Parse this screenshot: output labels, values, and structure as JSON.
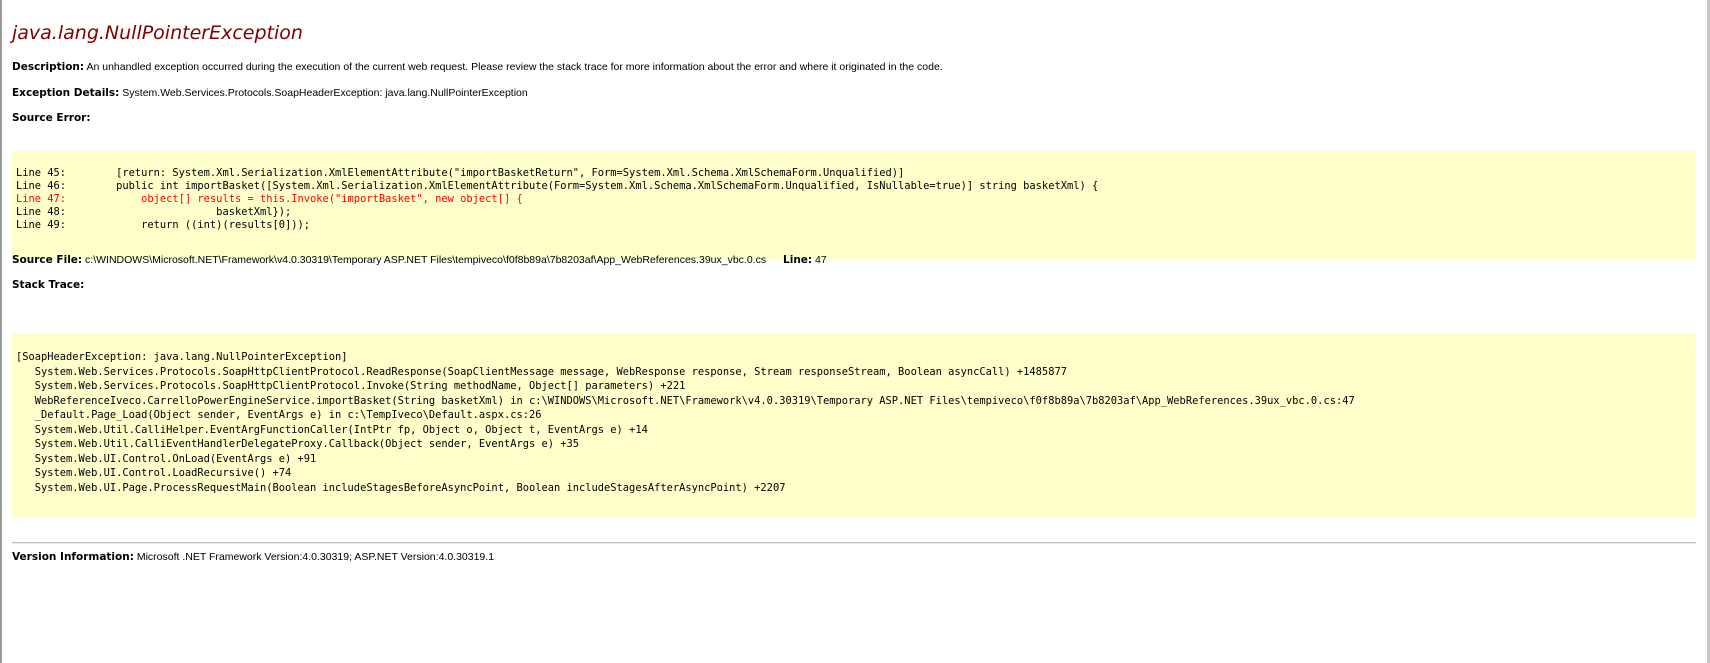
{
  "error": {
    "title": "java.lang.NullPointerException",
    "description_label": "Description:",
    "description_text": "An unhandled exception occurred during the execution of the current web request. Please review the stack trace for more information about the error and where it originated in the code.",
    "exception_label": "Exception Details:",
    "exception_text": "System.Web.Services.Protocols.SoapHeaderException: java.lang.NullPointerException"
  },
  "source_error": {
    "label": "Source Error:",
    "lines": [
      "Line 45:        [return: System.Xml.Serialization.XmlElementAttribute(\"importBasketReturn\", Form=System.Xml.Schema.XmlSchemaForm.Unqualified)]",
      "Line 46:        public int importBasket([System.Xml.Serialization.XmlElementAttribute(Form=System.Xml.Schema.XmlSchemaForm.Unqualified, IsNullable=true)] string basketXml) {",
      "Line 47:            object[] results = this.Invoke(\"importBasket\", new object[] {",
      "Line 48:                        basketXml});",
      "Line 49:            return ((int)(results[0]));"
    ],
    "highlight_index": 2
  },
  "source_file": {
    "label": "Source File:",
    "path": "c:\\WINDOWS\\Microsoft.NET\\Framework\\v4.0.30319\\Temporary ASP.NET Files\\tempiveco\\f0f8b89a\\7b8203af\\App_WebReferences.39ux_vbc.0.cs",
    "line_label": "Line:",
    "line_number": "47"
  },
  "stack_trace": {
    "label": "Stack Trace:",
    "lines": [
      "[SoapHeaderException: java.lang.NullPointerException]",
      "   System.Web.Services.Protocols.SoapHttpClientProtocol.ReadResponse(SoapClientMessage message, WebResponse response, Stream responseStream, Boolean asyncCall) +1485877",
      "   System.Web.Services.Protocols.SoapHttpClientProtocol.Invoke(String methodName, Object[] parameters) +221",
      "   WebReferenceIveco.CarrelloPowerEngineService.importBasket(String basketXml) in c:\\WINDOWS\\Microsoft.NET\\Framework\\v4.0.30319\\Temporary ASP.NET Files\\tempiveco\\f0f8b89a\\7b8203af\\App_WebReferences.39ux_vbc.0.cs:47",
      "   _Default.Page_Load(Object sender, EventArgs e) in c:\\TempIveco\\Default.aspx.cs:26",
      "   System.Web.Util.CalliHelper.EventArgFunctionCaller(IntPtr fp, Object o, Object t, EventArgs e) +14",
      "   System.Web.Util.CalliEventHandlerDelegateProxy.Callback(Object sender, EventArgs e) +35",
      "   System.Web.UI.Control.OnLoad(EventArgs e) +91",
      "   System.Web.UI.Control.LoadRecursive() +74",
      "   System.Web.UI.Page.ProcessRequestMain(Boolean includeStagesBeforeAsyncPoint, Boolean includeStagesAfterAsyncPoint) +2207"
    ]
  },
  "version": {
    "label": "Version Information:",
    "text": "Microsoft .NET Framework Version:4.0.30319; ASP.NET Version:4.0.30319.1"
  },
  "colors": {
    "title": "#800000",
    "code_background": "#ffffcc",
    "highlight_line": "#ff0000"
  }
}
